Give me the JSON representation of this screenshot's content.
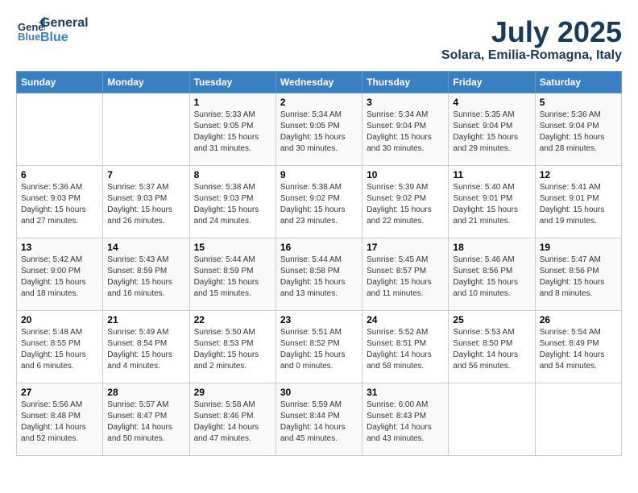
{
  "header": {
    "logo_general": "General",
    "logo_blue": "Blue",
    "month": "July 2025",
    "location": "Solara, Emilia-Romagna, Italy"
  },
  "weekdays": [
    "Sunday",
    "Monday",
    "Tuesday",
    "Wednesday",
    "Thursday",
    "Friday",
    "Saturday"
  ],
  "weeks": [
    [
      {
        "day": "",
        "detail": ""
      },
      {
        "day": "",
        "detail": ""
      },
      {
        "day": "1",
        "detail": "Sunrise: 5:33 AM\nSunset: 9:05 PM\nDaylight: 15 hours\nand 31 minutes."
      },
      {
        "day": "2",
        "detail": "Sunrise: 5:34 AM\nSunset: 9:05 PM\nDaylight: 15 hours\nand 30 minutes."
      },
      {
        "day": "3",
        "detail": "Sunrise: 5:34 AM\nSunset: 9:04 PM\nDaylight: 15 hours\nand 30 minutes."
      },
      {
        "day": "4",
        "detail": "Sunrise: 5:35 AM\nSunset: 9:04 PM\nDaylight: 15 hours\nand 29 minutes."
      },
      {
        "day": "5",
        "detail": "Sunrise: 5:36 AM\nSunset: 9:04 PM\nDaylight: 15 hours\nand 28 minutes."
      }
    ],
    [
      {
        "day": "6",
        "detail": "Sunrise: 5:36 AM\nSunset: 9:03 PM\nDaylight: 15 hours\nand 27 minutes."
      },
      {
        "day": "7",
        "detail": "Sunrise: 5:37 AM\nSunset: 9:03 PM\nDaylight: 15 hours\nand 26 minutes."
      },
      {
        "day": "8",
        "detail": "Sunrise: 5:38 AM\nSunset: 9:03 PM\nDaylight: 15 hours\nand 24 minutes."
      },
      {
        "day": "9",
        "detail": "Sunrise: 5:38 AM\nSunset: 9:02 PM\nDaylight: 15 hours\nand 23 minutes."
      },
      {
        "day": "10",
        "detail": "Sunrise: 5:39 AM\nSunset: 9:02 PM\nDaylight: 15 hours\nand 22 minutes."
      },
      {
        "day": "11",
        "detail": "Sunrise: 5:40 AM\nSunset: 9:01 PM\nDaylight: 15 hours\nand 21 minutes."
      },
      {
        "day": "12",
        "detail": "Sunrise: 5:41 AM\nSunset: 9:01 PM\nDaylight: 15 hours\nand 19 minutes."
      }
    ],
    [
      {
        "day": "13",
        "detail": "Sunrise: 5:42 AM\nSunset: 9:00 PM\nDaylight: 15 hours\nand 18 minutes."
      },
      {
        "day": "14",
        "detail": "Sunrise: 5:43 AM\nSunset: 8:59 PM\nDaylight: 15 hours\nand 16 minutes."
      },
      {
        "day": "15",
        "detail": "Sunrise: 5:44 AM\nSunset: 8:59 PM\nDaylight: 15 hours\nand 15 minutes."
      },
      {
        "day": "16",
        "detail": "Sunrise: 5:44 AM\nSunset: 8:58 PM\nDaylight: 15 hours\nand 13 minutes."
      },
      {
        "day": "17",
        "detail": "Sunrise: 5:45 AM\nSunset: 8:57 PM\nDaylight: 15 hours\nand 11 minutes."
      },
      {
        "day": "18",
        "detail": "Sunrise: 5:46 AM\nSunset: 8:56 PM\nDaylight: 15 hours\nand 10 minutes."
      },
      {
        "day": "19",
        "detail": "Sunrise: 5:47 AM\nSunset: 8:56 PM\nDaylight: 15 hours\nand 8 minutes."
      }
    ],
    [
      {
        "day": "20",
        "detail": "Sunrise: 5:48 AM\nSunset: 8:55 PM\nDaylight: 15 hours\nand 6 minutes."
      },
      {
        "day": "21",
        "detail": "Sunrise: 5:49 AM\nSunset: 8:54 PM\nDaylight: 15 hours\nand 4 minutes."
      },
      {
        "day": "22",
        "detail": "Sunrise: 5:50 AM\nSunset: 8:53 PM\nDaylight: 15 hours\nand 2 minutes."
      },
      {
        "day": "23",
        "detail": "Sunrise: 5:51 AM\nSunset: 8:52 PM\nDaylight: 15 hours\nand 0 minutes."
      },
      {
        "day": "24",
        "detail": "Sunrise: 5:52 AM\nSunset: 8:51 PM\nDaylight: 14 hours\nand 58 minutes."
      },
      {
        "day": "25",
        "detail": "Sunrise: 5:53 AM\nSunset: 8:50 PM\nDaylight: 14 hours\nand 56 minutes."
      },
      {
        "day": "26",
        "detail": "Sunrise: 5:54 AM\nSunset: 8:49 PM\nDaylight: 14 hours\nand 54 minutes."
      }
    ],
    [
      {
        "day": "27",
        "detail": "Sunrise: 5:56 AM\nSunset: 8:48 PM\nDaylight: 14 hours\nand 52 minutes."
      },
      {
        "day": "28",
        "detail": "Sunrise: 5:57 AM\nSunset: 8:47 PM\nDaylight: 14 hours\nand 50 minutes."
      },
      {
        "day": "29",
        "detail": "Sunrise: 5:58 AM\nSunset: 8:46 PM\nDaylight: 14 hours\nand 47 minutes."
      },
      {
        "day": "30",
        "detail": "Sunrise: 5:59 AM\nSunset: 8:44 PM\nDaylight: 14 hours\nand 45 minutes."
      },
      {
        "day": "31",
        "detail": "Sunrise: 6:00 AM\nSunset: 8:43 PM\nDaylight: 14 hours\nand 43 minutes."
      },
      {
        "day": "",
        "detail": ""
      },
      {
        "day": "",
        "detail": ""
      }
    ]
  ]
}
